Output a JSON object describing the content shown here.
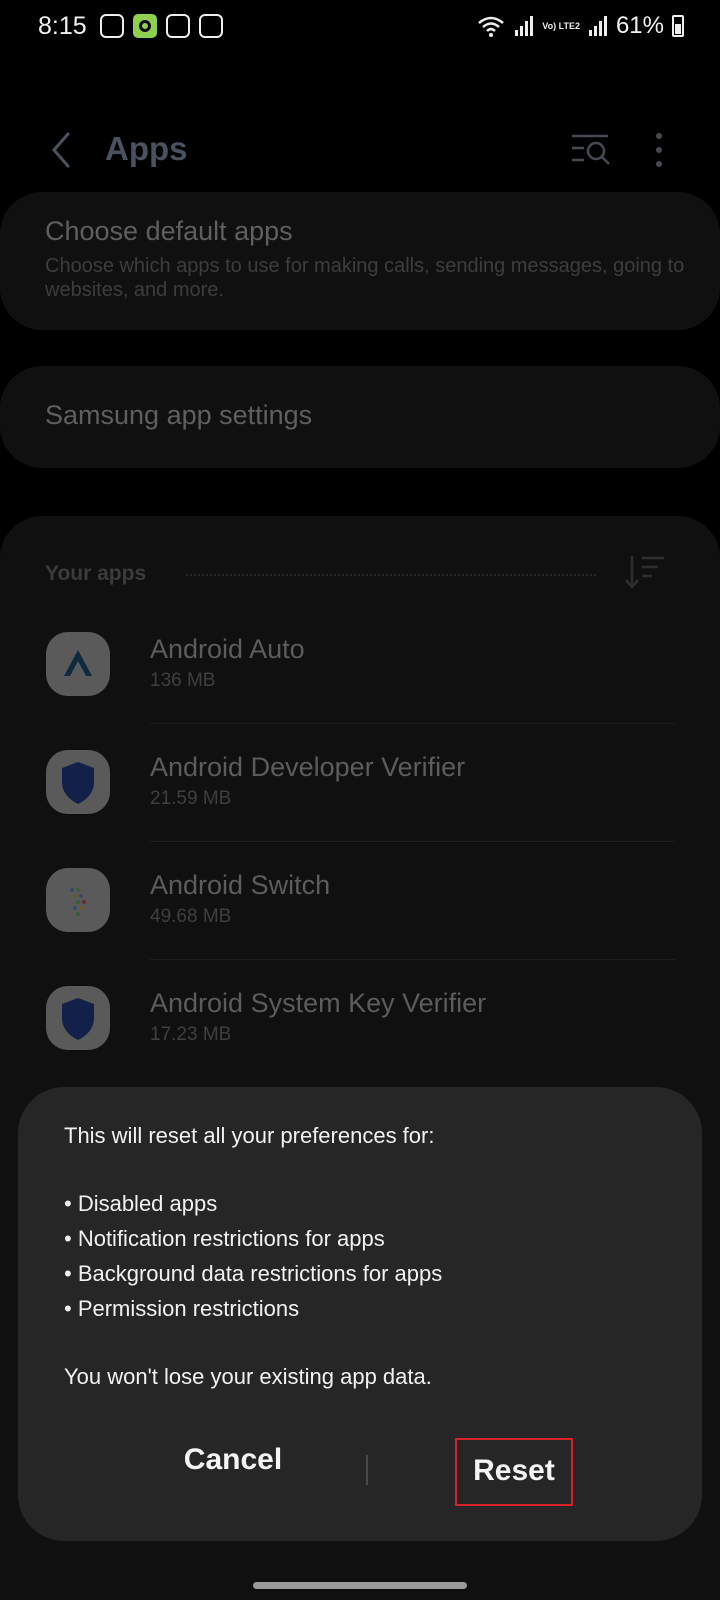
{
  "status_bar": {
    "time": "8:15",
    "battery": "61%",
    "network_label": "Vo) LTE2"
  },
  "app_bar": {
    "title": "Apps"
  },
  "default_apps": {
    "title": "Choose default apps",
    "subtitle": "Choose which apps to use for making calls, sending messages, going to websites, and more."
  },
  "samsung_settings": {
    "title": "Samsung app settings"
  },
  "your_apps": {
    "header": "Your apps",
    "items": [
      {
        "name": "Android Auto",
        "size": "136 MB",
        "icon": "android-auto-icon"
      },
      {
        "name": "Android Developer Verifier",
        "size": "21.59 MB",
        "icon": "shield-icon"
      },
      {
        "name": "Android Switch",
        "size": "49.68 MB",
        "icon": "android-switch-icon"
      },
      {
        "name": "Android System Key Verifier",
        "size": "17.23 MB",
        "icon": "shield-icon"
      }
    ]
  },
  "dialog": {
    "intro": "This will reset all your preferences for:",
    "bullets": [
      "• Disabled apps",
      "• Notification restrictions for apps",
      "• Background data restrictions for apps",
      "• Permission restrictions"
    ],
    "note": "You won't lose your existing app data.",
    "cancel_label": "Cancel",
    "reset_label": "Reset",
    "highlight_color": "#d9212c"
  }
}
